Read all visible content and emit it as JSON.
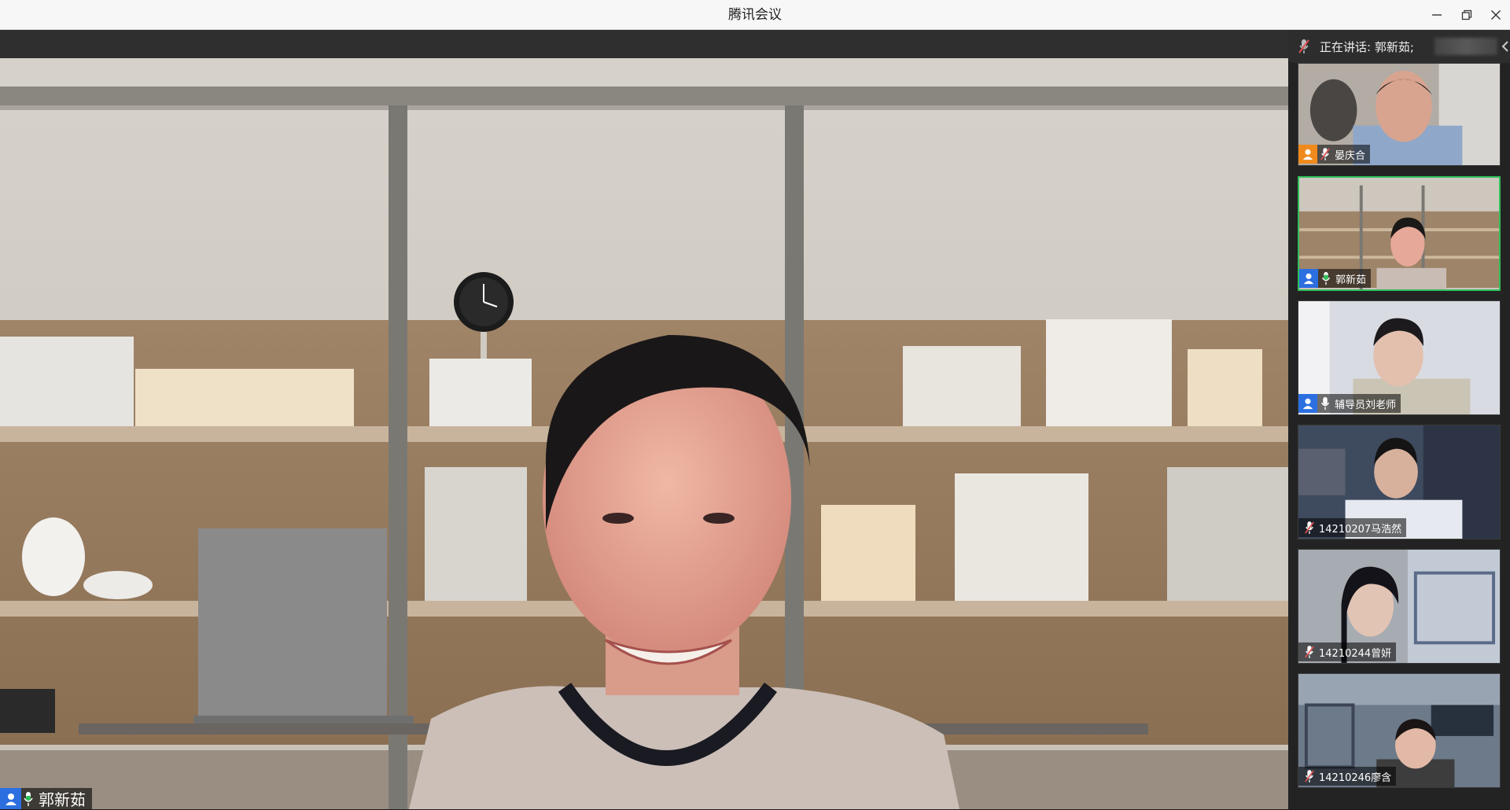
{
  "window": {
    "title": "腾讯会议"
  },
  "colors": {
    "accent": "#2b6fe0",
    "active_speaker_border": "#2fbf5a",
    "muted_red": "#e05050",
    "host_orange": "#f08a1c"
  },
  "main_speaker": {
    "name": "郭新茹",
    "avatar_icon": "user-icon",
    "mic_state": "speaking"
  },
  "speaking_bar": {
    "text": "正在讲话: 郭新茹;"
  },
  "participants": [
    {
      "name": "晏庆合",
      "role": "host",
      "mic_state": "muted"
    },
    {
      "name": "郭新茹",
      "role": "member",
      "mic_state": "speaking",
      "active": true
    },
    {
      "name": "辅导员刘老师",
      "role": "member",
      "mic_state": "on"
    },
    {
      "name": "14210207马浩然",
      "role": "none",
      "mic_state": "muted"
    },
    {
      "name": "14210244曾妍",
      "role": "none",
      "mic_state": "muted"
    },
    {
      "name": "14210246廖含",
      "role": "none",
      "mic_state": "muted"
    }
  ]
}
